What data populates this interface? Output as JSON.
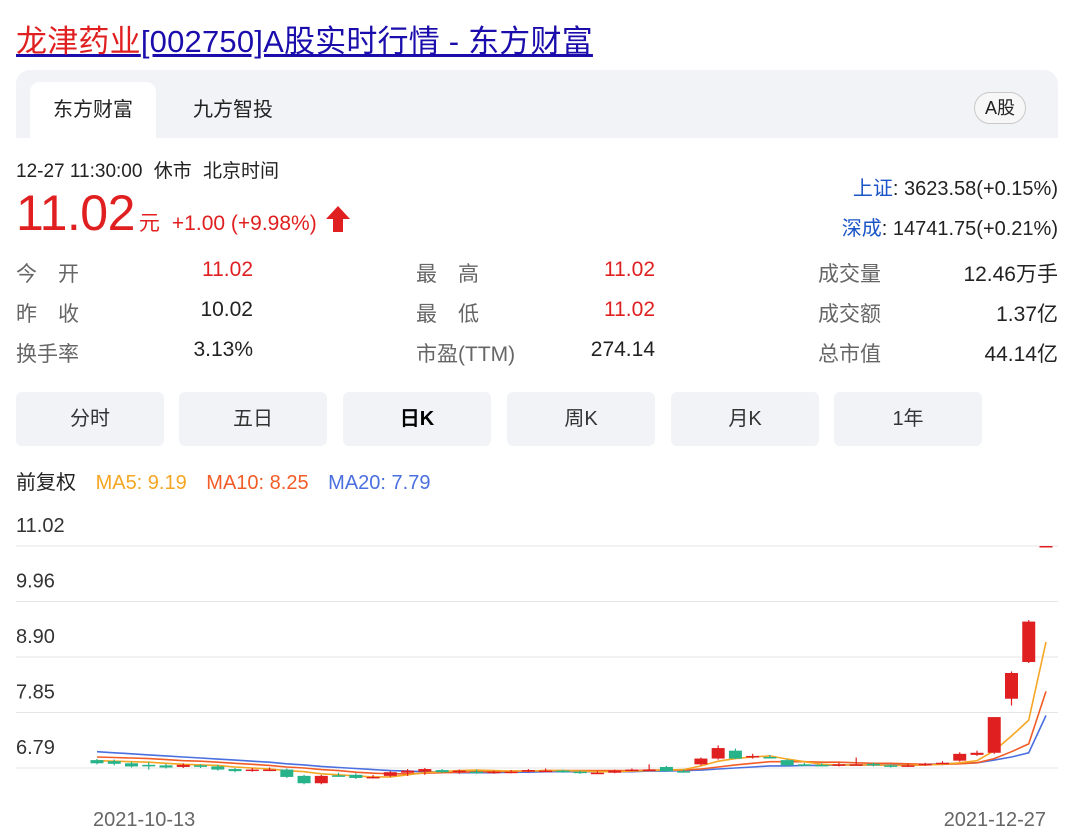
{
  "header": {
    "title_stock": "龙津药业",
    "title_rest": "[002750]A股实时行情 - 东方财富"
  },
  "tabs": [
    {
      "label": "东方财富"
    },
    {
      "label": "九方智投"
    }
  ],
  "market_badge": "A股",
  "status": {
    "datetime": "12-27 11:30:00",
    "state": "休市",
    "timezone": "北京时间"
  },
  "quote": {
    "price": "11.02",
    "unit": "元",
    "change": "+1.00 (+9.98%)"
  },
  "indices": [
    {
      "name": "上证",
      "value": ": 3623.58(+0.15%)"
    },
    {
      "name": "深成",
      "value": ": 14741.75(+0.21%)"
    }
  ],
  "stats": [
    {
      "label": "今　开",
      "value": "11.02"
    },
    {
      "label": "最　高",
      "value": "11.02"
    },
    {
      "label": "成交量",
      "value": "12.46万手"
    },
    {
      "label": "昨　收",
      "value": "10.02"
    },
    {
      "label": "最　低",
      "value": "11.02"
    },
    {
      "label": "成交额",
      "value": "1.37亿"
    },
    {
      "label": "换手率",
      "value": "3.13%"
    },
    {
      "label": "市盈(TTM)",
      "value": "274.14"
    },
    {
      "label": "总市值",
      "value": "44.14亿"
    }
  ],
  "periods": [
    {
      "label": "分时"
    },
    {
      "label": "五日"
    },
    {
      "label": "日K"
    },
    {
      "label": "周K"
    },
    {
      "label": "月K"
    },
    {
      "label": "1年"
    }
  ],
  "active_period": "日K",
  "ma_legend": {
    "adjust": "前复权",
    "ma5": "MA5: 9.19",
    "ma10": "MA10: 8.25",
    "ma20": "MA20: 7.79"
  },
  "colors": {
    "up": "#e02020",
    "down": "#26b38a",
    "ma5": "#f5a623",
    "ma10": "#f25c27",
    "ma20": "#4a6fe0",
    "link": "#1a0dab",
    "index_name": "#1a55c8"
  },
  "chart_data": {
    "type": "candlestick",
    "ylim": [
      6.79,
      11.02
    ],
    "y_ticks": [
      "11.02",
      "9.96",
      "8.90",
      "7.85",
      "6.79"
    ],
    "x_ticks": [
      "2021-10-13",
      "2021-12-27"
    ],
    "grid": true,
    "candles": [
      {
        "o": 6.94,
        "c": 6.88,
        "h": 6.96,
        "l": 6.86
      },
      {
        "o": 6.92,
        "c": 6.87,
        "h": 6.95,
        "l": 6.84
      },
      {
        "o": 6.88,
        "c": 6.82,
        "h": 6.91,
        "l": 6.8
      },
      {
        "o": 6.85,
        "c": 6.84,
        "h": 6.9,
        "l": 6.76
      },
      {
        "o": 6.84,
        "c": 6.8,
        "h": 6.87,
        "l": 6.78
      },
      {
        "o": 6.81,
        "c": 6.85,
        "h": 6.88,
        "l": 6.79
      },
      {
        "o": 6.84,
        "c": 6.82,
        "h": 6.86,
        "l": 6.79
      },
      {
        "o": 6.82,
        "c": 6.76,
        "h": 6.85,
        "l": 6.74
      },
      {
        "o": 6.77,
        "c": 6.73,
        "h": 6.79,
        "l": 6.71
      },
      {
        "o": 6.75,
        "c": 6.76,
        "h": 6.79,
        "l": 6.72
      },
      {
        "o": 6.76,
        "c": 6.76,
        "h": 6.8,
        "l": 6.73
      },
      {
        "o": 6.76,
        "c": 6.62,
        "h": 6.78,
        "l": 6.6
      },
      {
        "o": 6.64,
        "c": 6.5,
        "h": 6.66,
        "l": 6.48
      },
      {
        "o": 6.5,
        "c": 6.64,
        "h": 6.66,
        "l": 6.48
      },
      {
        "o": 6.65,
        "c": 6.64,
        "h": 6.7,
        "l": 6.62
      },
      {
        "o": 6.66,
        "c": 6.6,
        "h": 6.69,
        "l": 6.58
      },
      {
        "o": 6.62,
        "c": 6.62,
        "h": 6.66,
        "l": 6.59
      },
      {
        "o": 6.64,
        "c": 6.71,
        "h": 6.73,
        "l": 6.62
      },
      {
        "o": 6.7,
        "c": 6.74,
        "h": 6.77,
        "l": 6.64
      },
      {
        "o": 6.72,
        "c": 6.77,
        "h": 6.79,
        "l": 6.66
      },
      {
        "o": 6.75,
        "c": 6.71,
        "h": 6.77,
        "l": 6.7
      },
      {
        "o": 6.72,
        "c": 6.74,
        "h": 6.76,
        "l": 6.68
      },
      {
        "o": 6.72,
        "c": 6.7,
        "h": 6.76,
        "l": 6.68
      },
      {
        "o": 6.71,
        "c": 6.72,
        "h": 6.74,
        "l": 6.68
      },
      {
        "o": 6.72,
        "c": 6.72,
        "h": 6.75,
        "l": 6.69
      },
      {
        "o": 6.72,
        "c": 6.75,
        "h": 6.77,
        "l": 6.71
      },
      {
        "o": 6.74,
        "c": 6.74,
        "h": 6.78,
        "l": 6.72
      },
      {
        "o": 6.74,
        "c": 6.71,
        "h": 6.76,
        "l": 6.7
      },
      {
        "o": 6.72,
        "c": 6.7,
        "h": 6.74,
        "l": 6.68
      },
      {
        "o": 6.7,
        "c": 6.7,
        "h": 6.73,
        "l": 6.68
      },
      {
        "o": 6.7,
        "c": 6.74,
        "h": 6.76,
        "l": 6.69
      },
      {
        "o": 6.74,
        "c": 6.76,
        "h": 6.78,
        "l": 6.73
      },
      {
        "o": 6.76,
        "c": 6.76,
        "h": 6.86,
        "l": 6.74
      },
      {
        "o": 6.81,
        "c": 6.73,
        "h": 6.83,
        "l": 6.72
      },
      {
        "o": 6.73,
        "c": 6.72,
        "h": 6.76,
        "l": 6.7
      },
      {
        "o": 6.86,
        "c": 6.97,
        "h": 6.99,
        "l": 6.84
      },
      {
        "o": 6.97,
        "c": 7.17,
        "h": 7.22,
        "l": 6.95
      },
      {
        "o": 7.12,
        "c": 6.97,
        "h": 7.16,
        "l": 6.96
      },
      {
        "o": 6.99,
        "c": 7.02,
        "h": 7.06,
        "l": 6.97
      },
      {
        "o": 7.0,
        "c": 6.99,
        "h": 7.04,
        "l": 6.97
      },
      {
        "o": 6.94,
        "c": 6.84,
        "h": 6.96,
        "l": 6.82
      },
      {
        "o": 6.86,
        "c": 6.85,
        "h": 6.89,
        "l": 6.83
      },
      {
        "o": 6.85,
        "c": 6.84,
        "h": 6.88,
        "l": 6.82
      },
      {
        "o": 6.84,
        "c": 6.86,
        "h": 6.89,
        "l": 6.82
      },
      {
        "o": 6.86,
        "c": 6.86,
        "h": 6.99,
        "l": 6.84
      },
      {
        "o": 6.87,
        "c": 6.84,
        "h": 6.89,
        "l": 6.82
      },
      {
        "o": 6.84,
        "c": 6.82,
        "h": 6.86,
        "l": 6.8
      },
      {
        "o": 6.82,
        "c": 6.84,
        "h": 6.87,
        "l": 6.81
      },
      {
        "o": 6.84,
        "c": 6.87,
        "h": 6.89,
        "l": 6.83
      },
      {
        "o": 6.87,
        "c": 6.89,
        "h": 6.92,
        "l": 6.86
      },
      {
        "o": 6.93,
        "c": 7.06,
        "h": 7.09,
        "l": 6.91
      },
      {
        "o": 7.04,
        "c": 7.08,
        "h": 7.12,
        "l": 7.02
      },
      {
        "o": 7.08,
        "c": 7.76,
        "h": 7.76,
        "l": 7.06
      },
      {
        "o": 8.11,
        "c": 8.6,
        "h": 8.63,
        "l": 7.98
      },
      {
        "o": 8.81,
        "c": 9.58,
        "h": 9.61,
        "l": 8.79
      },
      {
        "o": 11.02,
        "c": 11.02,
        "h": 11.02,
        "l": 11.02
      }
    ],
    "ma5": [
      6.93,
      6.92,
      6.91,
      6.9,
      6.88,
      6.86,
      6.85,
      6.84,
      6.81,
      6.79,
      6.77,
      6.74,
      6.72,
      6.68,
      6.66,
      6.64,
      6.62,
      6.62,
      6.66,
      6.7,
      6.72,
      6.74,
      6.75,
      6.74,
      6.73,
      6.73,
      6.74,
      6.74,
      6.73,
      6.72,
      6.72,
      6.73,
      6.74,
      6.75,
      6.76,
      6.83,
      6.92,
      6.97,
      7.0,
      7.02,
      6.96,
      6.91,
      6.86,
      6.85,
      6.85,
      6.85,
      6.84,
      6.84,
      6.85,
      6.86,
      6.89,
      6.93,
      7.12,
      7.4,
      7.7,
      9.19
    ],
    "ma10": [
      7.0,
      6.99,
      6.98,
      6.97,
      6.95,
      6.93,
      6.92,
      6.9,
      6.88,
      6.86,
      6.84,
      6.81,
      6.79,
      6.76,
      6.74,
      6.71,
      6.69,
      6.68,
      6.68,
      6.69,
      6.7,
      6.71,
      6.72,
      6.72,
      6.73,
      6.73,
      6.74,
      6.74,
      6.74,
      6.74,
      6.74,
      6.74,
      6.75,
      6.75,
      6.75,
      6.77,
      6.81,
      6.85,
      6.88,
      6.91,
      6.91,
      6.91,
      6.9,
      6.9,
      6.89,
      6.88,
      6.88,
      6.87,
      6.86,
      6.86,
      6.87,
      6.89,
      6.97,
      7.1,
      7.25,
      8.25
    ],
    "ma20": [
      7.1,
      7.08,
      7.06,
      7.04,
      7.02,
      7.0,
      6.98,
      6.96,
      6.94,
      6.92,
      6.9,
      6.87,
      6.85,
      6.82,
      6.8,
      6.78,
      6.76,
      6.74,
      6.73,
      6.72,
      6.71,
      6.7,
      6.7,
      6.7,
      6.71,
      6.71,
      6.72,
      6.72,
      6.72,
      6.72,
      6.72,
      6.72,
      6.73,
      6.73,
      6.74,
      6.75,
      6.77,
      6.79,
      6.81,
      6.83,
      6.83,
      6.84,
      6.84,
      6.85,
      6.85,
      6.85,
      6.85,
      6.86,
      6.86,
      6.87,
      6.88,
      6.89,
      6.94,
      7.0,
      7.08,
      7.79
    ]
  }
}
